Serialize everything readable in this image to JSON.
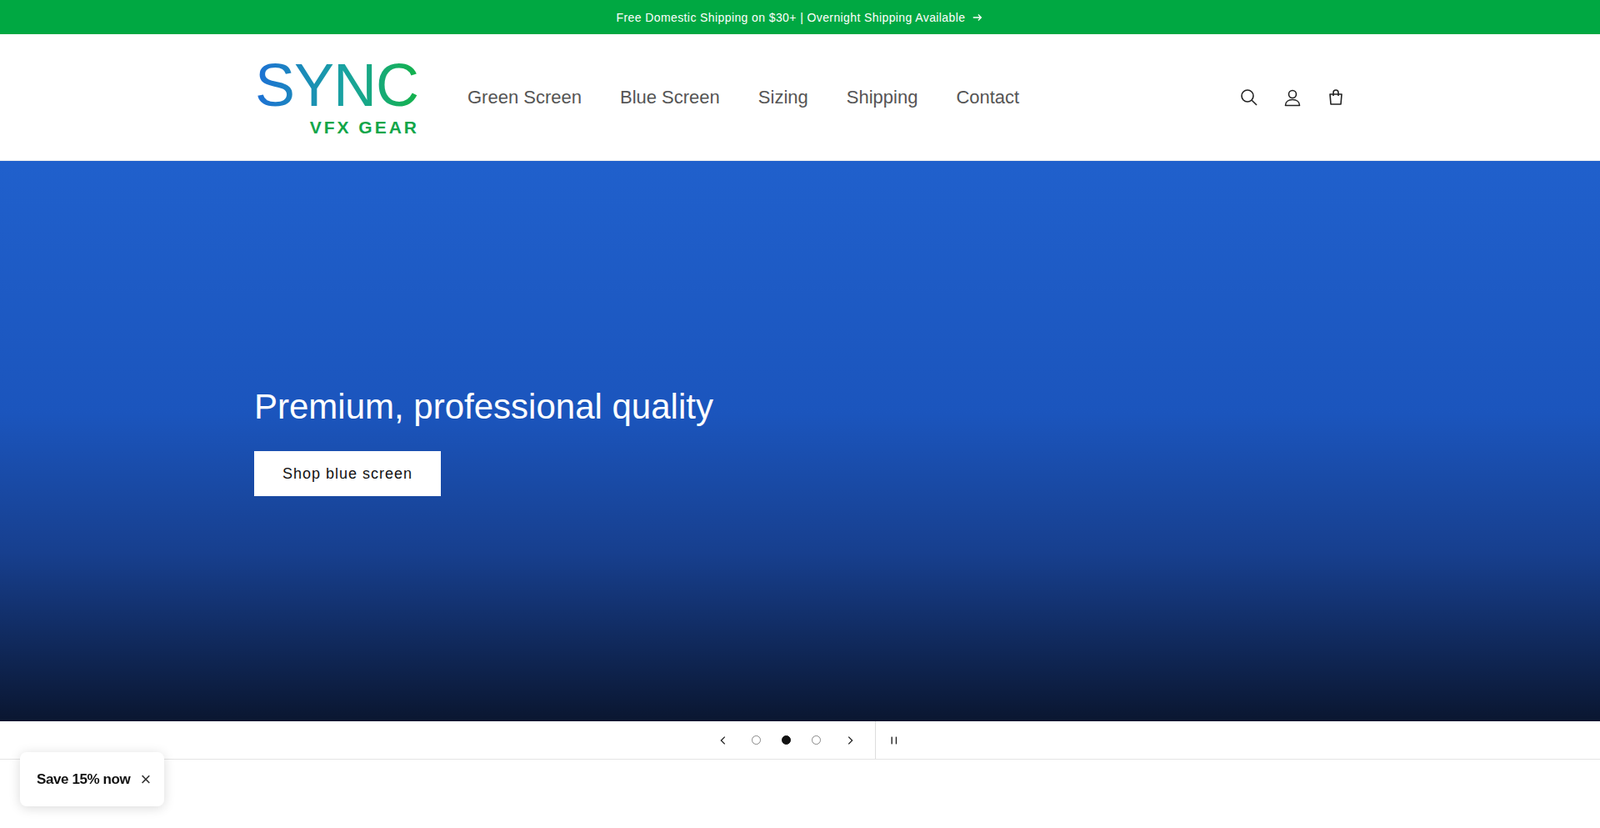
{
  "announcement": {
    "text": "Free Domestic Shipping on $30+ | Overnight Shipping Available"
  },
  "logo": {
    "name": "SYNC",
    "tagline": "VFX GEAR"
  },
  "nav": [
    {
      "label": "Green Screen",
      "selected": false
    },
    {
      "label": "Blue Screen",
      "selected": false
    },
    {
      "label": "Sizing",
      "selected": false
    },
    {
      "label": "Shipping",
      "selected": false
    },
    {
      "label": "Contact",
      "selected": false
    }
  ],
  "hero": {
    "heading": "Premium, professional quality",
    "button": "Shop blue screen"
  },
  "slider": {
    "slides": [
      {
        "selected": false
      },
      {
        "selected": true
      },
      {
        "selected": false
      }
    ],
    "playing": true
  },
  "popup": {
    "text": "Save 15% now",
    "close": "×"
  }
}
